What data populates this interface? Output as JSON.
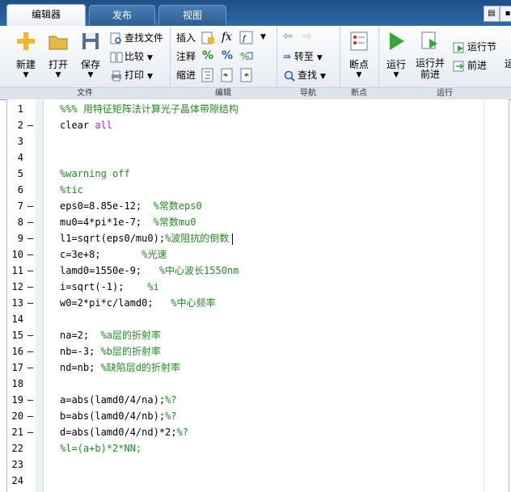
{
  "tabs": [
    {
      "label": "编辑器",
      "active": true
    },
    {
      "label": "发布",
      "active": false
    },
    {
      "label": "视图",
      "active": false
    }
  ],
  "ribbon": {
    "file_group": {
      "label": "文件",
      "new": "新建",
      "open": "打开",
      "save": "保存",
      "find_files": "查找文件",
      "compare": "比较",
      "print": "打印"
    },
    "edit_group": {
      "label": "编辑",
      "insert": "插入",
      "comment": "注释",
      "indent": "缩进"
    },
    "nav_group": {
      "label": "导航",
      "goto": "转至",
      "find": "查找"
    },
    "breakpoint_group": {
      "label": "断点",
      "breakpoints": "断点"
    },
    "run_group": {
      "label": "运行",
      "run": "运行",
      "run_advance_line1": "运行并",
      "run_advance_line2": "前进",
      "run_section": "运行节",
      "advance": "前进"
    }
  },
  "editor": {
    "lines": [
      {
        "n": "1",
        "dash": "",
        "code": "",
        "comment": "%%% 用特征矩阵法计算光子晶体带隙结构"
      },
      {
        "n": "2",
        "dash": "–",
        "code": "clear ",
        "kw": "all",
        "comment": ""
      },
      {
        "n": "3",
        "dash": "",
        "code": "",
        "comment": ""
      },
      {
        "n": "4",
        "dash": "",
        "code": "",
        "comment": ""
      },
      {
        "n": "5",
        "dash": "",
        "code": "",
        "comment": "%warning off"
      },
      {
        "n": "6",
        "dash": "",
        "code": "",
        "comment": "%tic"
      },
      {
        "n": "7",
        "dash": "–",
        "code": "eps0=8.85e-12;  ",
        "comment": "%常数eps0"
      },
      {
        "n": "8",
        "dash": "–",
        "code": "mu0=4*pi*1e-7;  ",
        "comment": "%常数mu0"
      },
      {
        "n": "9",
        "dash": "–",
        "code": "l1=sqrt(eps0/mu0);",
        "comment": "%波阻抗的倒数",
        "cursor": true
      },
      {
        "n": "10",
        "dash": "–",
        "code": "c=3e+8;       ",
        "comment": "%光速"
      },
      {
        "n": "11",
        "dash": "–",
        "code": "lamd0=1550e-9;   ",
        "comment": "%中心波长1550nm"
      },
      {
        "n": "12",
        "dash": "–",
        "code": "i=sqrt(-1);    ",
        "comment": "%i"
      },
      {
        "n": "13",
        "dash": "–",
        "code": "w0=2*pi*c/lamd0;   ",
        "comment": "%中心频率"
      },
      {
        "n": "14",
        "dash": "",
        "code": "",
        "comment": ""
      },
      {
        "n": "15",
        "dash": "–",
        "code": "na=2;  ",
        "comment": "%a层的折射率"
      },
      {
        "n": "16",
        "dash": "–",
        "code": "nb=-3; ",
        "comment": "%b层的折射率"
      },
      {
        "n": "17",
        "dash": "–",
        "code": "nd=nb; ",
        "comment": "%缺陷层d的折射率"
      },
      {
        "n": "18",
        "dash": "",
        "code": "",
        "comment": ""
      },
      {
        "n": "19",
        "dash": "–",
        "code": "a=abs(lamd0/4/na);",
        "comment": "%?"
      },
      {
        "n": "20",
        "dash": "–",
        "code": "b=abs(lamd0/4/nb);",
        "comment": "%?"
      },
      {
        "n": "21",
        "dash": "–",
        "code": "d=abs(lamd0/4/nd)*2;",
        "comment": "%?"
      },
      {
        "n": "22",
        "dash": "",
        "code": "",
        "comment": "%l=(a+b)*2*NN;"
      },
      {
        "n": "23",
        "dash": "",
        "code": "",
        "comment": ""
      },
      {
        "n": "24",
        "dash": "",
        "code": "",
        "comment": ""
      }
    ]
  }
}
